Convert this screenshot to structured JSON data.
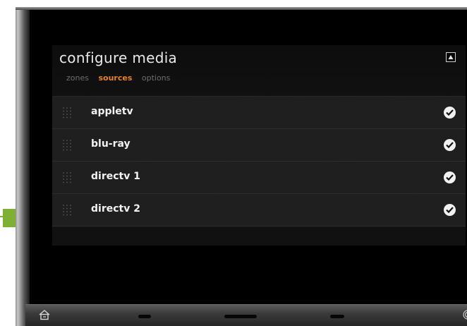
{
  "header": {
    "title": "configure media"
  },
  "tabs": [
    {
      "label": "zones",
      "active": false
    },
    {
      "label": "sources",
      "active": true
    },
    {
      "label": "options",
      "active": false
    }
  ],
  "sources": [
    {
      "label": "appletv",
      "checked": true
    },
    {
      "label": "blu-ray",
      "checked": true
    },
    {
      "label": "directv 1",
      "checked": true
    },
    {
      "label": "directv 2",
      "checked": true
    }
  ],
  "icons": {
    "collapse": "triangle-up-icon",
    "row_handle": "drag-grip-icon",
    "row_check": "check-circle-icon",
    "home": "home-icon",
    "power": "power-icon"
  },
  "colors": {
    "accent": "#e8822a",
    "indicator": "#7fb035",
    "background": "#000000"
  }
}
